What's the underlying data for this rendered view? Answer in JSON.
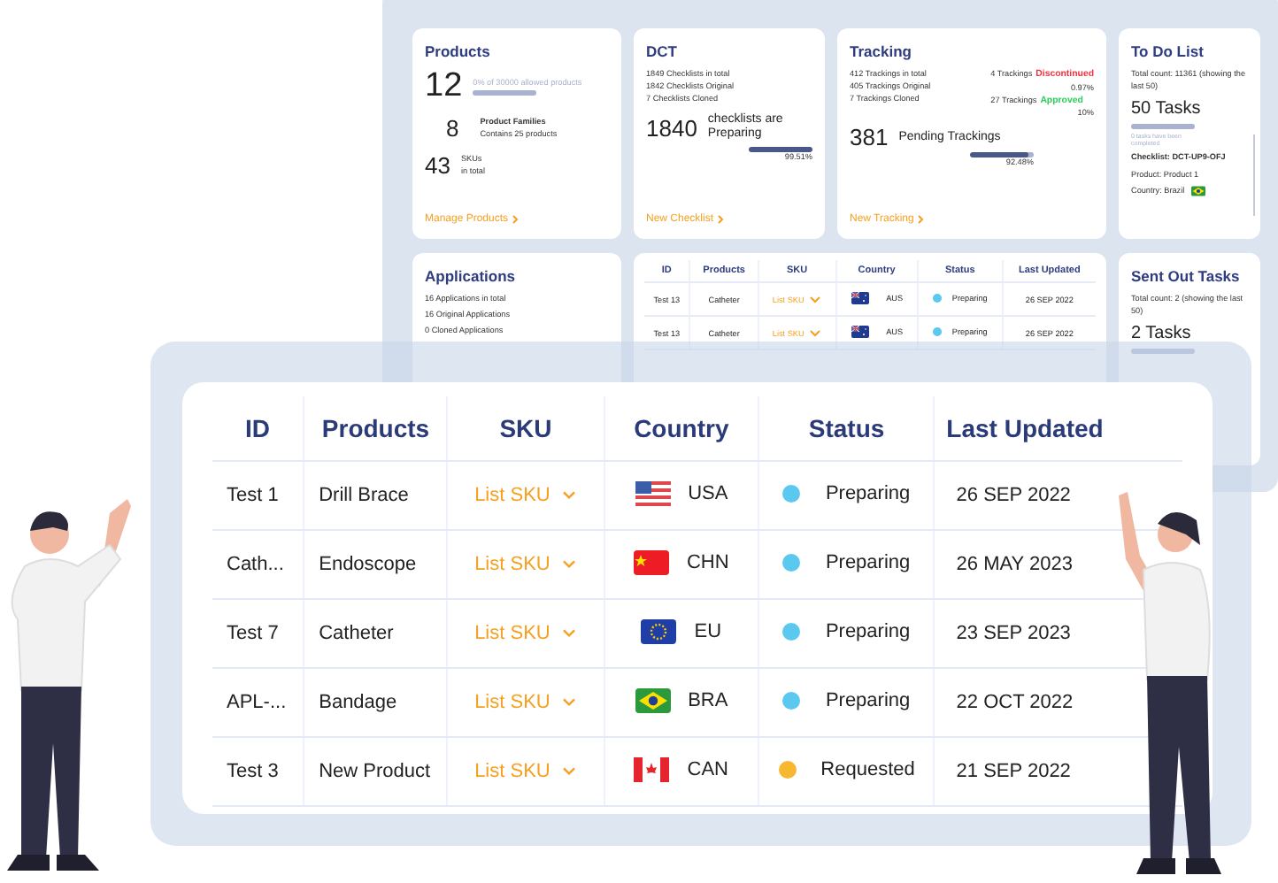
{
  "dashboard": {
    "products": {
      "title": "Products",
      "total": "12",
      "allowance": "0% of 30000 allowed products",
      "level": 0,
      "families_count": "8",
      "families_label": "Product Families",
      "families_detail": "Contains 25 products",
      "skus_count": "43",
      "skus_label": "SKUs",
      "skus_detail": "in total",
      "link": "Manage Products"
    },
    "dct": {
      "title": "DCT",
      "lines": [
        "1849 Checklists in total",
        "1842 Checklists Original",
        "7 Checklists Cloned"
      ],
      "count": "1840",
      "caption": "checklists are Preparing",
      "level": 0.9951,
      "reading": "99.51%",
      "link": "New Checklist"
    },
    "tracking": {
      "title": "Tracking",
      "lines": [
        "412 Trackings in total",
        "405 Trackings Original",
        "7 Trackings Cloned"
      ],
      "statuses": [
        {
          "count": "4 Trackings",
          "label": "Discontinued",
          "color": "#f0323c",
          "share": "0.97%"
        },
        {
          "count": "27 Trackings",
          "label": "Approved",
          "color": "#2ccd5a",
          "share": "10%"
        }
      ],
      "count": "381",
      "caption": "Pending Trackings",
      "level": 0.9248,
      "reading": "92.48%",
      "link": "New Tracking"
    },
    "todo": {
      "title": "To Do List",
      "total": "Total count: 11361 (showing the last 50)",
      "tasks": "50 Tasks",
      "level": 0,
      "note": "0 tasks have been completed",
      "checklist": "Checklist: DCT-UP9-OFJ",
      "product": "Product: Product 1",
      "country": "Country: Brazil",
      "flag": {
        "kind": "bra"
      }
    },
    "applications": {
      "title": "Applications",
      "lines": [
        "16 Applications in total",
        "16 Original Applications",
        "0 Cloned Applications"
      ]
    },
    "mini_table": {
      "columns": [
        "ID",
        "Products",
        "SKU",
        "Country",
        "Status",
        "Last Updated"
      ],
      "rows": [
        {
          "id": "Test 13",
          "product": "Catheter",
          "sku": "List SKU",
          "flag": {
            "kind": "aus"
          },
          "country": "AUS",
          "color": "#5bc8ef",
          "status": "Preparing",
          "updated": "26 SEP 2022"
        },
        {
          "id": "Test 13",
          "product": "Catheter",
          "sku": "List SKU",
          "flag": {
            "kind": "aus"
          },
          "country": "AUS",
          "color": "#5bc8ef",
          "status": "Preparing",
          "updated": "26 SEP 2022"
        }
      ]
    },
    "sent_out": {
      "title": "Sent Out Tasks",
      "total": "Total count: 2 (showing the last 50)",
      "tasks": "2 Tasks",
      "level": 0
    }
  },
  "table": {
    "columns": [
      "ID",
      "Products",
      "SKU",
      "Country",
      "Status",
      "Last Updated"
    ],
    "rows": [
      {
        "id": "Test 1",
        "product": "Drill Brace",
        "sku": "List SKU",
        "flag": {
          "kind": "usa"
        },
        "country": "USA",
        "color": "#5bc8ef",
        "status": "Preparing",
        "updated": "26 SEP 2022"
      },
      {
        "id": "Cath...",
        "product": "Endoscope",
        "sku": "List SKU",
        "flag": {
          "kind": "chn"
        },
        "country": "CHN",
        "color": "#5bc8ef",
        "status": "Preparing",
        "updated": "26 MAY 2023"
      },
      {
        "id": "Test 7",
        "product": "Catheter",
        "sku": "List SKU",
        "flag": {
          "kind": "eu"
        },
        "country": "EU",
        "color": "#5bc8ef",
        "status": "Preparing",
        "updated": "23 SEP 2023"
      },
      {
        "id": "APL-...",
        "product": "Bandage",
        "sku": "List SKU",
        "flag": {
          "kind": "bra"
        },
        "country": "BRA",
        "color": "#5bc8ef",
        "status": "Preparing",
        "updated": "22 OCT 2022"
      },
      {
        "id": "Test 3",
        "product": "New Product",
        "sku": "List SKU",
        "flag": {
          "kind": "can"
        },
        "country": "CAN",
        "color": "#f7b731",
        "status": "Requested",
        "updated": "21 SEP 2022"
      }
    ]
  }
}
